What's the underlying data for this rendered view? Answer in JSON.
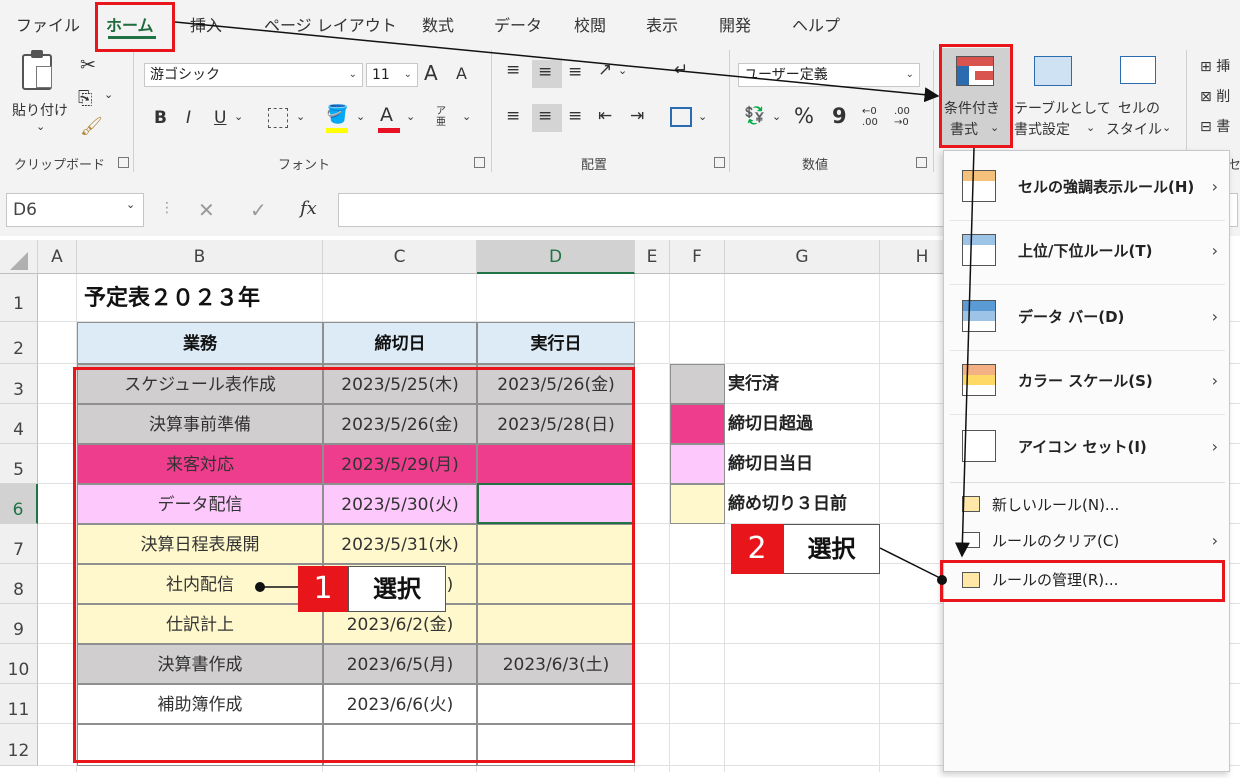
{
  "ribbon": {
    "tabs": [
      "ファイル",
      "ホーム",
      "挿入",
      "ページ レイアウト",
      "数式",
      "データ",
      "校閲",
      "表示",
      "開発",
      "ヘルプ"
    ],
    "active_tab": "ホーム",
    "clipboard": {
      "paste": "貼り付け",
      "group": "クリップボード"
    },
    "font": {
      "name": "游ゴシック",
      "size": "11",
      "bold": "B",
      "italic": "I",
      "underline": "U",
      "grow": "A",
      "shrink": "A",
      "color": "A",
      "phonetic": "ア亜",
      "group": "フォント"
    },
    "alignment": {
      "group": "配置"
    },
    "number": {
      "format": "ユーザー定義",
      "percent": "%",
      "comma": "9",
      "inc": "←0 .00",
      "dec": ".00 →0",
      "group": "数値"
    },
    "styles": {
      "cond_line1": "条件付き",
      "cond_line2": "書式",
      "table_line1": "テーブルとして",
      "table_line2": "書式設定",
      "cell_line1": "セルの",
      "cell_line2": "スタイル"
    },
    "cells_partial": [
      "挿",
      "削",
      "書"
    ],
    "edge_group": "セ"
  },
  "formula_bar": {
    "name_box": "D6",
    "fx": "fx"
  },
  "columns": [
    "A",
    "B",
    "C",
    "D",
    "E",
    "F",
    "G",
    "H"
  ],
  "rows": [
    "1",
    "2",
    "3",
    "4",
    "5",
    "6",
    "7",
    "8",
    "9",
    "10",
    "11",
    "12"
  ],
  "sheet": {
    "title": "予定表２０２３年",
    "headers": [
      "業務",
      "締切日",
      "実行日"
    ],
    "table": [
      {
        "task": "スケジュール表作成",
        "due": "2023/5/25(木)",
        "done": "2023/5/26(金)"
      },
      {
        "task": "決算事前準備",
        "due": "2023/5/26(金)",
        "done": "2023/5/28(日)"
      },
      {
        "task": "来客対応",
        "due": "2023/5/29(月)",
        "done": ""
      },
      {
        "task": "データ配信",
        "due": "2023/5/30(火)",
        "done": ""
      },
      {
        "task": "決算日程表展開",
        "due": "2023/5/31(水)",
        "done": ""
      },
      {
        "task": "社内配信",
        "due": "2023/6/1(木)",
        "done": ""
      },
      {
        "task": "仕訳計上",
        "due": "2023/6/2(金)",
        "done": ""
      },
      {
        "task": "決算書作成",
        "due": "2023/6/5(月)",
        "done": "2023/6/3(土)"
      },
      {
        "task": "補助簿作成",
        "due": "2023/6/6(火)",
        "done": ""
      },
      {
        "task": "",
        "due": "",
        "done": ""
      }
    ],
    "legend": [
      "実行済",
      "締切日超過",
      "締切日当日",
      "締め切り３日前"
    ]
  },
  "colors": {
    "executed": "#d0cece",
    "overdue": "#ee3d8c",
    "today": "#fdc8fb",
    "three_days": "#fef8cc",
    "header": "#ddebf7",
    "callout_red": "#e8151b"
  },
  "cond_menu": {
    "items": [
      {
        "label": "セルの強調表示ルール(H)",
        "icon": "highlight-rules-icon"
      },
      {
        "label": "上位/下位ルール(T)",
        "icon": "top-bottom-icon"
      },
      {
        "label": "データ バー(D)",
        "icon": "data-bar-icon"
      },
      {
        "label": "カラー スケール(S)",
        "icon": "color-scale-icon"
      },
      {
        "label": "アイコン セット(I)",
        "icon": "icon-set-icon"
      }
    ],
    "new_rule": "新しいルール(N)...",
    "clear_rules": "ルールのクリア(C)",
    "manage_rules": "ルールの管理(R)..."
  },
  "callouts": [
    {
      "num": "1",
      "text": "選択"
    },
    {
      "num": "2",
      "text": "選択"
    }
  ]
}
